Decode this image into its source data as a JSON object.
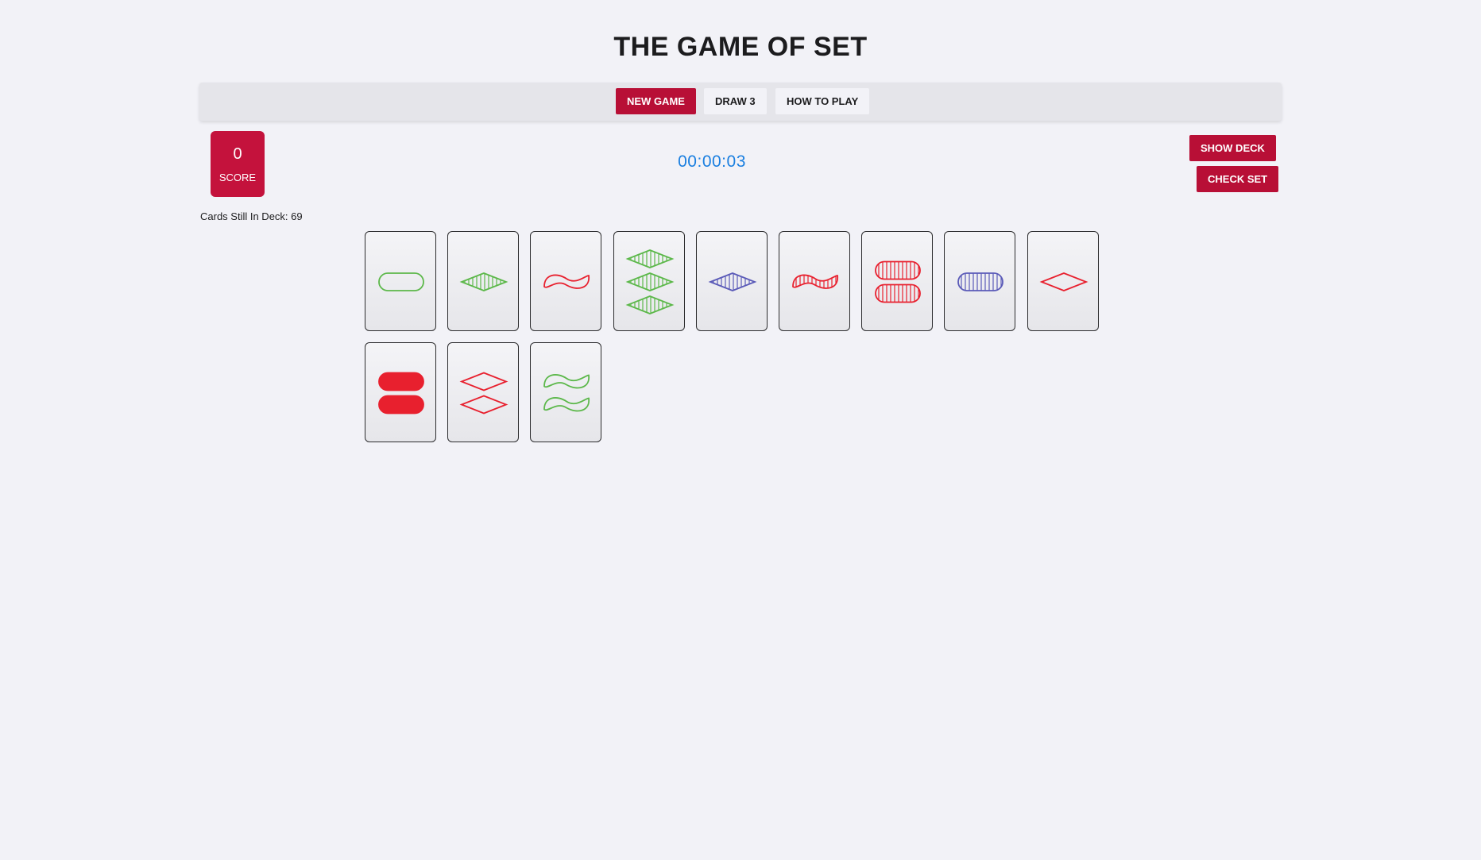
{
  "header": {
    "title": "THE GAME OF SET"
  },
  "nav": {
    "new_game": "NEW GAME",
    "draw_3": "DRAW 3",
    "how_to_play": "HOW TO PLAY"
  },
  "score": {
    "value": "0",
    "label": "SCORE"
  },
  "timer": "00:00:03",
  "controls": {
    "show_deck": "SHOW DECK",
    "check_set": "CHECK SET"
  },
  "deck": {
    "label": "Cards Still In Deck: 69"
  },
  "colors": {
    "accent": "#c4123c",
    "red": "#e8202e",
    "green": "#5cb84a",
    "purple": "#5a5ab8",
    "timer": "#1a7fe0"
  },
  "cards": [
    {
      "count": 1,
      "shape": "oval",
      "color": "green",
      "fill": "empty"
    },
    {
      "count": 1,
      "shape": "diamond",
      "color": "green",
      "fill": "striped"
    },
    {
      "count": 1,
      "shape": "squiggle",
      "color": "red",
      "fill": "empty"
    },
    {
      "count": 3,
      "shape": "diamond",
      "color": "green",
      "fill": "striped"
    },
    {
      "count": 1,
      "shape": "diamond",
      "color": "purple",
      "fill": "striped"
    },
    {
      "count": 1,
      "shape": "squiggle",
      "color": "red",
      "fill": "striped"
    },
    {
      "count": 2,
      "shape": "oval",
      "color": "red",
      "fill": "striped"
    },
    {
      "count": 1,
      "shape": "oval",
      "color": "purple",
      "fill": "striped"
    },
    {
      "count": 1,
      "shape": "diamond",
      "color": "red",
      "fill": "empty"
    },
    {
      "count": 2,
      "shape": "oval",
      "color": "red",
      "fill": "solid"
    },
    {
      "count": 2,
      "shape": "diamond",
      "color": "red",
      "fill": "empty"
    },
    {
      "count": 2,
      "shape": "squiggle",
      "color": "green",
      "fill": "empty"
    }
  ]
}
